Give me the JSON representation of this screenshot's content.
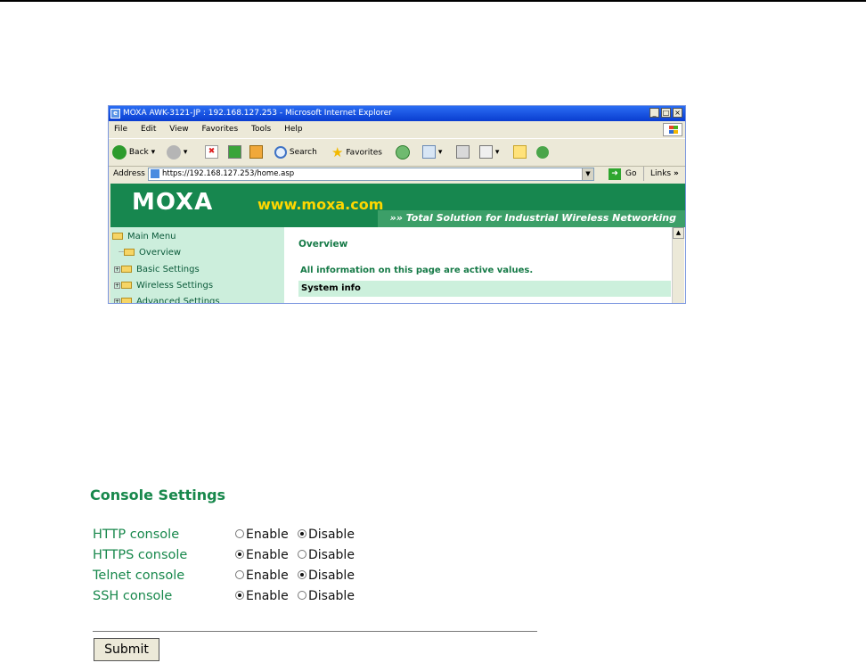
{
  "browser": {
    "title": "MOXA AWK-3121-JP : 192.168.127.253 - Microsoft Internet Explorer",
    "menu": [
      "File",
      "Edit",
      "View",
      "Favorites",
      "Tools",
      "Help"
    ],
    "toolbar": {
      "back": "Back",
      "search": "Search",
      "favorites": "Favorites"
    },
    "address_label": "Address",
    "url": "https://192.168.127.253/home.asp",
    "go_label": "Go",
    "links_label": "Links"
  },
  "page": {
    "logo": "MOXA",
    "logo_url": "www.moxa.com",
    "tagline": "Total Solution for Industrial Wireless Networking",
    "nav": [
      "Main Menu",
      "Overview",
      "Basic Settings",
      "Wireless Settings",
      "Advanced Settings"
    ],
    "overview_title": "Overview",
    "overview_note": "All information on this page are active values.",
    "system_info": "System info"
  },
  "console": {
    "title": "Console Settings",
    "enable_label": "Enable",
    "disable_label": "Disable",
    "rows": [
      {
        "label": "HTTP console",
        "enabled": false
      },
      {
        "label": "HTTPS console",
        "enabled": true
      },
      {
        "label": "Telnet console",
        "enabled": false
      },
      {
        "label": "SSH console",
        "enabled": true
      }
    ],
    "submit_label": "Submit"
  },
  "colors": {
    "accent_green": "#18884c",
    "banner_green": "#17874f",
    "nav_bg": "#cceedc"
  }
}
